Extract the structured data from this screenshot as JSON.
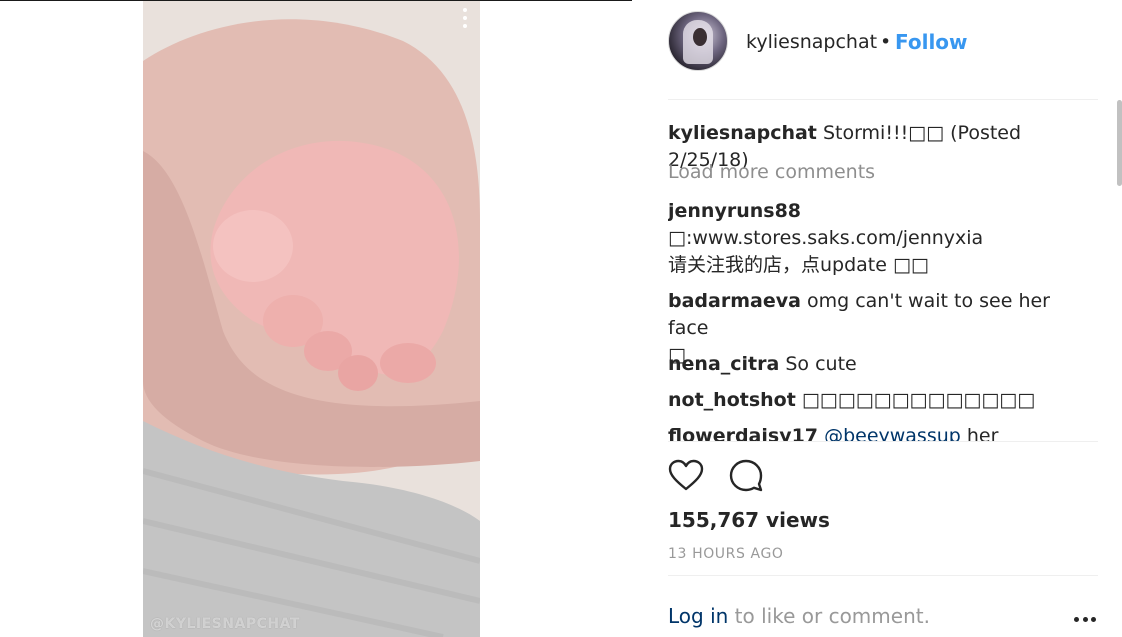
{
  "media": {
    "watermark": "@KYLIESNAPCHAT"
  },
  "header": {
    "username": "kyliesnapchat",
    "separator": "•",
    "follow_label": "Follow"
  },
  "comments": [
    {
      "user": "kyliesnapchat",
      "text": "Stormi!!!□□ (Posted 2/25/18)"
    },
    {
      "load_more": "Load more comments"
    },
    {
      "user": "jennyruns88",
      "line1": "□:www.stores.saks.com/jennyxia",
      "line2": "请关注我的店，点update □□"
    },
    {
      "user": "badarmaeva",
      "text": "omg can't wait to see her face",
      "line2": "□"
    },
    {
      "user": "nena_citra",
      "text": "So cute"
    },
    {
      "user": "not_hotshot",
      "text": "□□□□□□□□□□□□□"
    },
    {
      "user": "flowerdaisy17",
      "mention": "@beeywassup",
      "text": "her Snapchat"
    }
  ],
  "stats": {
    "views": "155,767 views",
    "timestamp": "13 HOURS AGO"
  },
  "footer": {
    "login_link": "Log in",
    "login_rest": " to like or comment."
  },
  "colors": {
    "link_blue": "#3897f0",
    "dark_link": "#003569",
    "muted": "#999999"
  },
  "icons": [
    "more-vertical-icon",
    "heart-icon",
    "comment-icon",
    "more-horizontal-icon"
  ]
}
